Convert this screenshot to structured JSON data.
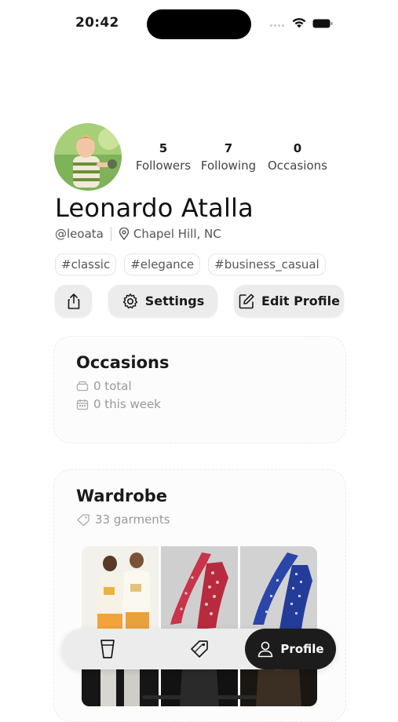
{
  "status_bar": {
    "time": "20:42"
  },
  "profile": {
    "name": "Leonardo Atalla",
    "handle": "@leoata",
    "location": "Chapel Hill, NC",
    "stats": [
      {
        "value": "5",
        "label": "Followers"
      },
      {
        "value": "7",
        "label": "Following"
      },
      {
        "value": "0",
        "label": "Occasions"
      }
    ],
    "tags": [
      "#classic",
      "#elegance",
      "#business_casual"
    ]
  },
  "actions": {
    "share_icon": "share-icon",
    "settings_label": "Settings",
    "edit_label": "Edit Profile"
  },
  "occasions_card": {
    "title": "Occasions",
    "total": "0 total",
    "this_week": "0 this week"
  },
  "wardrobe_card": {
    "title": "Wardrobe",
    "count": "33 garments"
  },
  "tab_bar": {
    "tabs": [
      {
        "icon": "glass-icon",
        "label": ""
      },
      {
        "icon": "tag-icon",
        "label": ""
      },
      {
        "icon": "person-icon",
        "label": "Profile"
      }
    ],
    "active": "Profile"
  },
  "colors": {
    "background": "#ffffff",
    "button_bg": "#ececec",
    "active_tab": "#1c1c1c",
    "tie_red": "#c8344a",
    "tie_blue": "#2b45a8"
  }
}
